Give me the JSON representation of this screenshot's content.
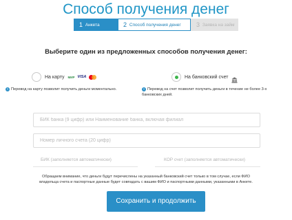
{
  "title": "Способ получения денег",
  "steps": [
    {
      "num": "1",
      "label": "Анкета",
      "state": "done"
    },
    {
      "num": "2",
      "label": "Способ получения денег",
      "state": "active"
    },
    {
      "num": "3",
      "label": "Заявка на займ",
      "state": "upcoming"
    }
  ],
  "question": "Выберите один из предложенных способов получения денег:",
  "options": {
    "card": {
      "label": "На карту",
      "selected": false,
      "logos": {
        "mir": "МИР",
        "visa": "VISA"
      },
      "note": "Перевод на карту позволит получить деньги моментально."
    },
    "account": {
      "label": "На банковский счет",
      "selected": true,
      "icon": "bank-icon",
      "note": "Перевод на счет позволит получить деньги в течение не более 3-х банковских дней."
    }
  },
  "fields": {
    "bik": {
      "placeholder": "БИК банка (9 цифр) или Наименование банка, включая филиал",
      "value": ""
    },
    "account_number": {
      "placeholder": "Номер личного счета (20 цифр)",
      "value": ""
    },
    "bik_auto": "БИК (заполняется автоматически)",
    "kor_auto": "КОР счет (заполняется автоматически)"
  },
  "disclaimer": "Обращаем внимание, что деньги будут перечислены на указанный банковский счет только в том случае, если ФИО владельца счета и паспортные данные будет совпадать с вашим ФИО и паспортными данными, указанными в Анкете.",
  "submit_label": "Сохранить и продолжить",
  "colors": {
    "accent": "#2a8fc7",
    "title": "#1f95c6",
    "selected_radio": "#3bb44a",
    "step_inactive": "#e3e3e3"
  }
}
